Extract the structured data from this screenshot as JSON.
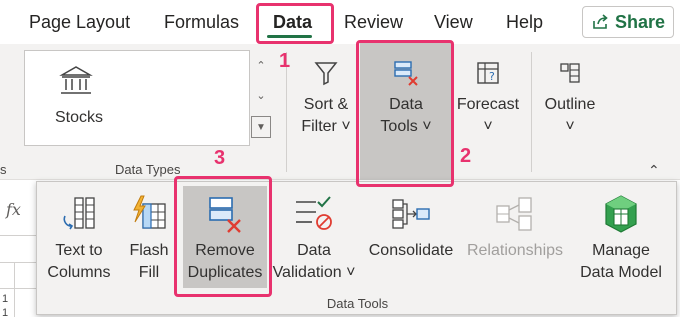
{
  "tabs": [
    {
      "label": "Page Layout",
      "active": false
    },
    {
      "label": "Formulas",
      "active": false
    },
    {
      "label": "Data",
      "active": true
    },
    {
      "label": "Review",
      "active": false
    },
    {
      "label": "View",
      "active": false
    },
    {
      "label": "Help",
      "active": false
    }
  ],
  "share": {
    "label": "Share"
  },
  "ribbon": {
    "data_types": {
      "gallery_item": "Stocks",
      "group_label": "Data Types"
    },
    "sort_filter": {
      "line1": "Sort &",
      "line2": "Filter ˅"
    },
    "data_tools": {
      "line1": "Data",
      "line2": "Tools ˅"
    },
    "forecast": {
      "line1": "Forecast",
      "line2": "˅"
    },
    "outline": {
      "line1": "Outline",
      "line2": "˅"
    }
  },
  "formula_bar": {
    "fx": "fx"
  },
  "rows": [
    "1",
    "1"
  ],
  "panel": {
    "group_label": "Data Tools",
    "buttons": {
      "text_to_columns": {
        "line1": "Text to",
        "line2": "Columns"
      },
      "flash_fill": {
        "line1": "Flash",
        "line2": "Fill"
      },
      "remove_duplicates": {
        "line1": "Remove",
        "line2": "Duplicates"
      },
      "data_validation": {
        "line1": "Data",
        "line2": "Validation ˅"
      },
      "consolidate": {
        "line1": "Consolidate"
      },
      "relationships": {
        "line1": "Relationships",
        "disabled": true
      },
      "manage_data_model": {
        "line1": "Manage",
        "line2": "Data Model"
      }
    }
  },
  "annotations": {
    "step1": "1",
    "step2": "2",
    "step3": "3"
  },
  "colors": {
    "accent": "#217346",
    "annotation": "#e8326e",
    "ribbon_bg": "#f3f2f1"
  }
}
